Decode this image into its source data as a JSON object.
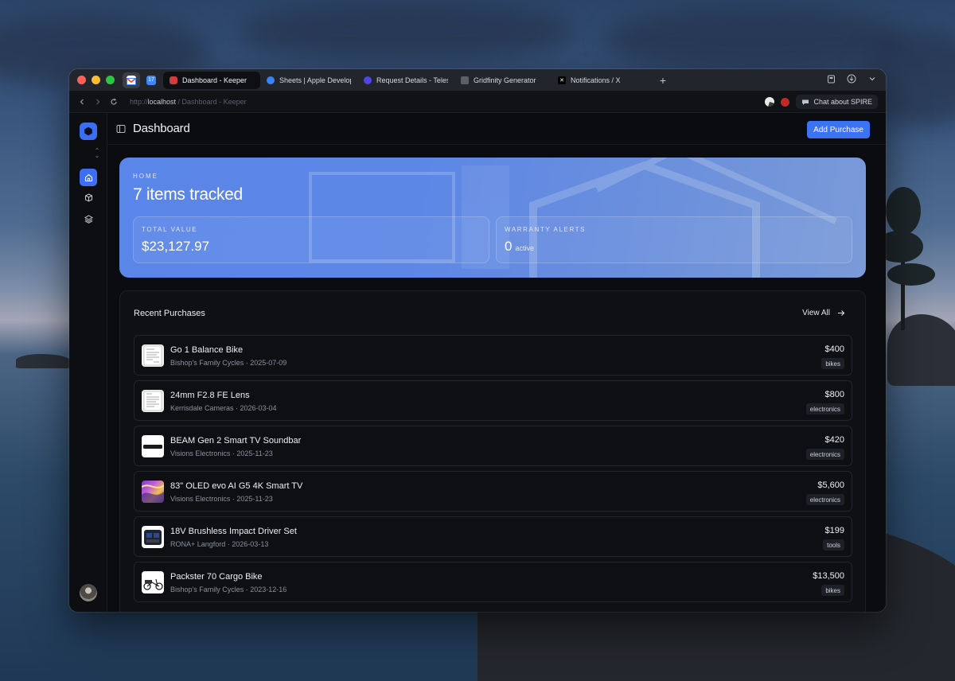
{
  "browser": {
    "tabs": [
      {
        "label": "Dashboard - Keeper",
        "active": true,
        "favicon": "keeper-logo",
        "color": "#d23b3b"
      },
      {
        "label": "Sheets | Apple Develop",
        "active": false,
        "favicon": "apple-developer-icon",
        "color": "#3b82f6"
      },
      {
        "label": "Request Details - Teles",
        "active": false,
        "favicon": "telescope-icon",
        "color": "#4f46e5"
      },
      {
        "label": "Gridfinity Generator",
        "active": false,
        "favicon": "gridfinity-icon",
        "color": "#5b5f66"
      },
      {
        "label": "Notifications / X",
        "active": false,
        "favicon": "x-logo-icon",
        "color": "#000000"
      }
    ],
    "pinned_tabs": [
      {
        "icon": "gmail-icon",
        "color": "#ea4335"
      },
      {
        "icon": "calendar-icon",
        "color": "#4285f4",
        "text": "17"
      }
    ],
    "url": {
      "scheme": "http://",
      "host": "localhost",
      "path": " / Dashboard - Keeper"
    },
    "chat_button": "Chat about SPIRE"
  },
  "app": {
    "header": {
      "title": "Dashboard",
      "add_button": "Add Purchase"
    },
    "hero": {
      "eyebrow": "HOME",
      "title": "7 items tracked",
      "stats": [
        {
          "label": "TOTAL VALUE",
          "value": "$23,127.97",
          "suffix": ""
        },
        {
          "label": "WARRANTY ALERTS",
          "value": "0",
          "suffix": "active"
        }
      ]
    },
    "recent": {
      "title": "Recent Purchases",
      "view_all": "View All",
      "items": [
        {
          "name": "Go 1 Balance Bike",
          "meta": "Bishop's Family Cycles · 2025-07-09",
          "price": "$400",
          "tag": "bikes",
          "thumb": "receipt"
        },
        {
          "name": "24mm F2.8 FE Lens",
          "meta": "Kerrisdale Cameras · 2026-03-04",
          "price": "$800",
          "tag": "electronics",
          "thumb": "receipt"
        },
        {
          "name": "BEAM Gen 2 Smart TV Soundbar",
          "meta": "Visions Electronics · 2025-11-23",
          "price": "$420",
          "tag": "electronics",
          "thumb": "soundbar"
        },
        {
          "name": "83\" OLED evo AI G5 4K Smart TV",
          "meta": "Visions Electronics · 2025-11-23",
          "price": "$5,600",
          "tag": "electronics",
          "thumb": "tv"
        },
        {
          "name": "18V Brushless Impact Driver Set",
          "meta": "RONA+ Langford · 2026-03-13",
          "price": "$199",
          "tag": "tools",
          "thumb": "toolcase"
        },
        {
          "name": "Packster 70 Cargo Bike",
          "meta": "Bishop's Family Cycles · 2023-12-16",
          "price": "$13,500",
          "tag": "bikes",
          "thumb": "cargobike"
        }
      ]
    }
  },
  "colors": {
    "accent": "#3b73f2",
    "hero": "#5a86e9",
    "background": "#0b0c10"
  }
}
